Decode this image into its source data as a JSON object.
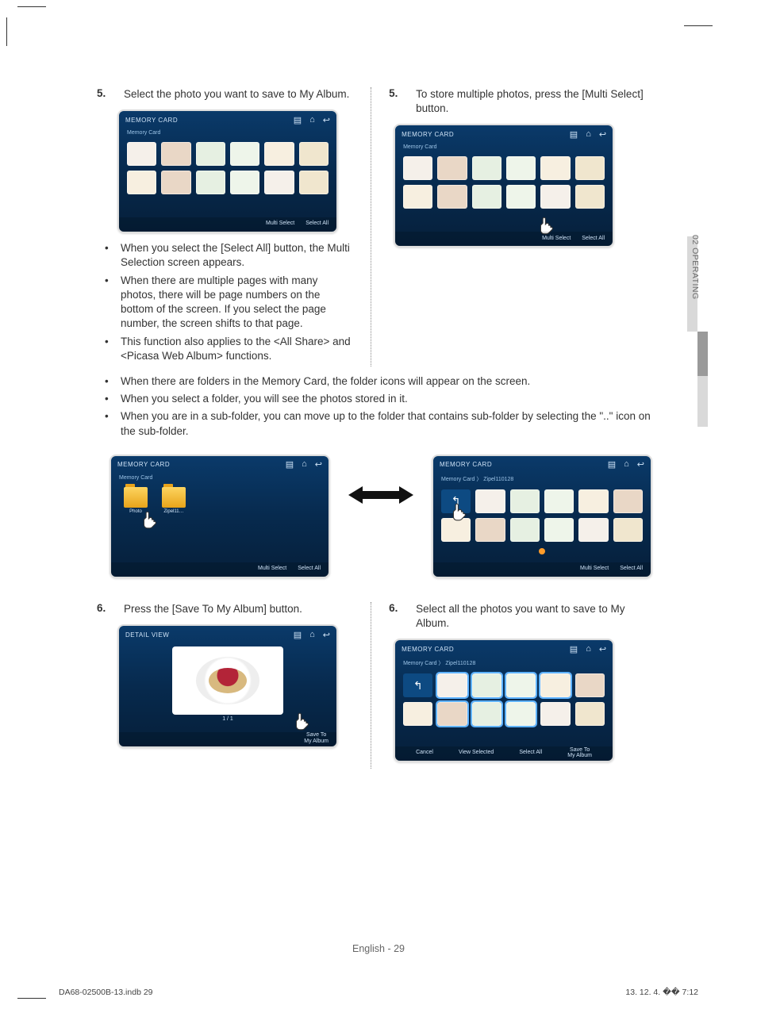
{
  "tab": "02  OPERATING",
  "left": {
    "step5_num": "5.",
    "step5_text": "Select the photo you want to save to My Album.",
    "bullets": [
      "When you select the [Select All] button, the Multi Selection screen appears.",
      "When there are multiple pages with many photos, there will be page numbers on the bottom of the screen. If you select the page number, the screen shifts to that page.",
      "This function also applies to the <All Share> and <Picasa Web Album> functions."
    ],
    "step6_num": "6.",
    "step6_text": "Press the [Save To My Album] button."
  },
  "right": {
    "step5_num": "5.",
    "step5_text": "To store multiple photos, press the [Multi Select] button.",
    "step6_num": "6.",
    "step6_text": "Select all the photos you want to save to My Album."
  },
  "wide_bullets": [
    "When there are folders in the Memory Card, the folder icons will appear on the screen.",
    "When you select a folder, you will see the photos stored in it.",
    "When you are in a sub-folder, you can move up to the folder that contains sub-folder by selecting the \"..\" icon on the sub-folder."
  ],
  "ui": {
    "title": "MEMORY CARD",
    "detail_title": "DETAIL VIEW",
    "breadcrumb1": "Memory Card",
    "breadcrumb2": "Memory Card  〉 Zipel110128",
    "multi_select": "Multi Select",
    "select_all": "Select All",
    "cancel": "Cancel",
    "view_selected": "View Selected",
    "save_to_my_album": "Save To\nMy Album",
    "pager": "1 / 1",
    "folder_photo": "Photo",
    "folder_zipel": "Zipel11…",
    "up": "↰"
  },
  "footer": "English - 29",
  "meta_left": "DA68-02500B-13.indb   29",
  "meta_right": "13. 12. 4.   �� 7:12"
}
